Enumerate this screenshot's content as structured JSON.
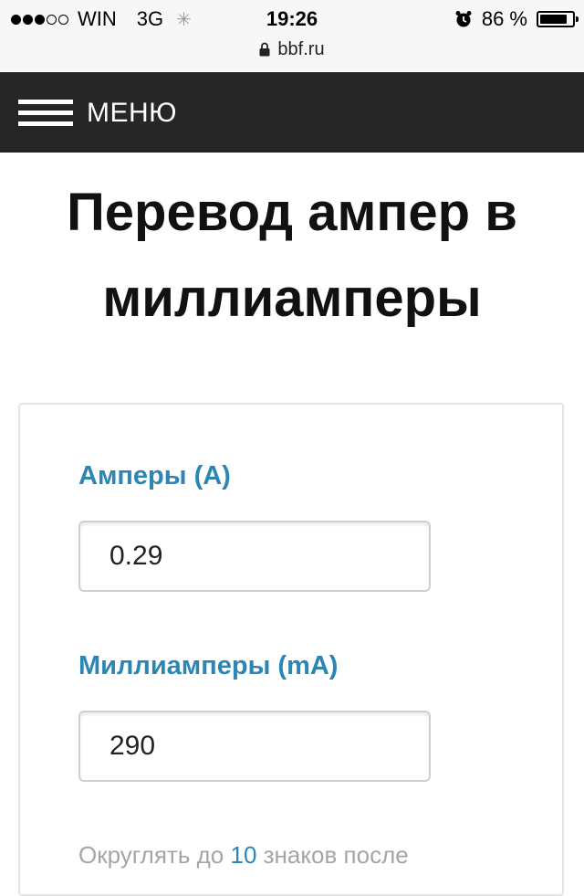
{
  "status_bar": {
    "carrier": "WIN",
    "network": "3G",
    "time": "19:26",
    "battery_percent": "86 %",
    "battery_level": 0.86,
    "url": "bbf.ru",
    "signal_strength": "3 of 5",
    "icons": [
      "signal-dots-icon",
      "loading-spinner-icon",
      "alarm-icon",
      "battery-icon",
      "lock-icon"
    ]
  },
  "menu": {
    "label": "МЕНЮ"
  },
  "page": {
    "title_line1": "Перевод ампер в",
    "title_line2": "миллиамперы"
  },
  "converter": {
    "amperes_label": "Амперы (A)",
    "amperes_value": "0.29",
    "milliamperes_label": "Миллиамперы (mA)",
    "milliamperes_value": "290",
    "rounding_prefix": "Округлять до",
    "rounding_digits": "10",
    "rounding_suffix": "знаков после"
  },
  "colors": {
    "menu_background": "#262626",
    "accent": "#2b86b5",
    "muted_text": "#a5a5a5"
  }
}
